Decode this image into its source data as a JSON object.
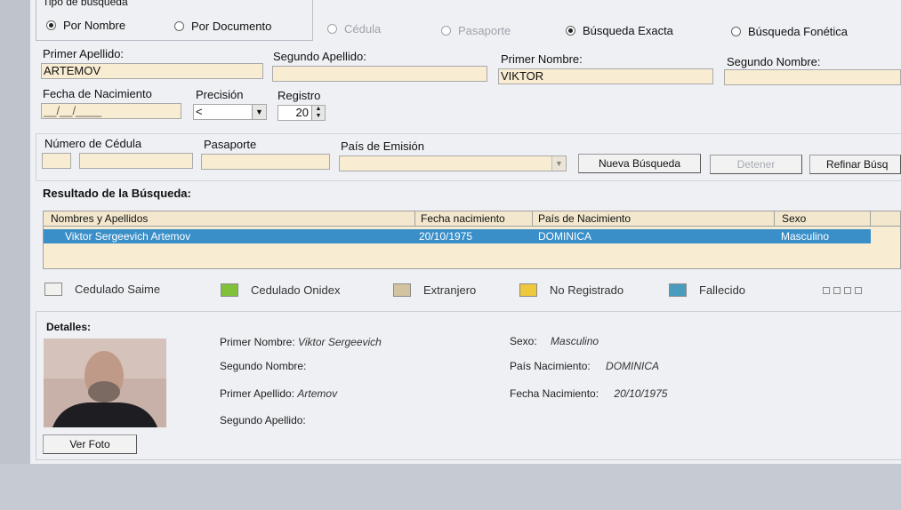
{
  "search_type": {
    "group_label": "Tipo de búsqueda",
    "options": [
      "Por Nombre",
      "Por Documento"
    ],
    "selected": "Por Nombre"
  },
  "doc_type": {
    "options": [
      "Cédula",
      "Pasaporte"
    ]
  },
  "match_type": {
    "options": [
      "Búsqueda Exacta",
      "Búsqueda Fonética"
    ],
    "selected": "Búsqueda Exacta"
  },
  "form": {
    "primer_apellido": {
      "label": "Primer Apellido:",
      "value": "ARTEMOV"
    },
    "segundo_apellido": {
      "label": "Segundo Apellido:",
      "value": ""
    },
    "primer_nombre": {
      "label": "Primer Nombre:",
      "value": "VIKTOR"
    },
    "segundo_nombre": {
      "label": "Segundo Nombre:",
      "value": ""
    },
    "fecha_nacimiento": {
      "label": "Fecha de Nacimiento",
      "value": "__/__/____"
    },
    "precision": {
      "label": "Precisión",
      "value": "<"
    },
    "registro": {
      "label": "Registro",
      "value": "20"
    },
    "numero_cedula": {
      "label": "Número de Cédula",
      "value": ""
    },
    "pasaporte": {
      "label": "Pasaporte",
      "value": ""
    },
    "pais_emision": {
      "label": "País de Emisión",
      "value": ""
    }
  },
  "buttons": {
    "nueva_busqueda": "Nueva Búsqueda",
    "detener": "Detener",
    "refinar": "Refinar Búsq"
  },
  "results": {
    "title": "Resultado de la Búsqueda:",
    "columns": [
      "Nombres y Apellidos",
      "Fecha nacimiento",
      "País de Nacimiento",
      "Sexo"
    ],
    "rows": [
      [
        "Viktor Sergeevich Artemov",
        "20/10/1975",
        "DOMINICA",
        "Masculino"
      ]
    ]
  },
  "legend": [
    {
      "label": "Cedulado Saime",
      "color": "#f1f1ee"
    },
    {
      "label": "Cedulado Onidex",
      "color": "#7fc23a"
    },
    {
      "label": "Extranjero",
      "color": "#d4c3a0"
    },
    {
      "label": "No Registrado",
      "color": "#efc83c"
    },
    {
      "label": "Fallecido",
      "color": "#4a9cbf"
    }
  ],
  "details": {
    "title": "Detalles:",
    "primer_nombre": {
      "label": "Primer Nombre:",
      "value": "Viktor Sergeevich"
    },
    "segundo_nombre": {
      "label": "Segundo Nombre:",
      "value": ""
    },
    "primer_apellido": {
      "label": "Primer Apellido:",
      "value": "Artemov"
    },
    "segundo_apellido": {
      "label": "Segundo Apellido:",
      "value": ""
    },
    "sexo": {
      "label": "Sexo:",
      "value": "Masculino"
    },
    "pais_nacimiento": {
      "label": "País Nacimiento:",
      "value": "DOMINICA"
    },
    "fecha_nacimiento": {
      "label": "Fecha Nacimiento:",
      "value": "20/10/1975"
    },
    "ver_foto": "Ver Foto"
  }
}
